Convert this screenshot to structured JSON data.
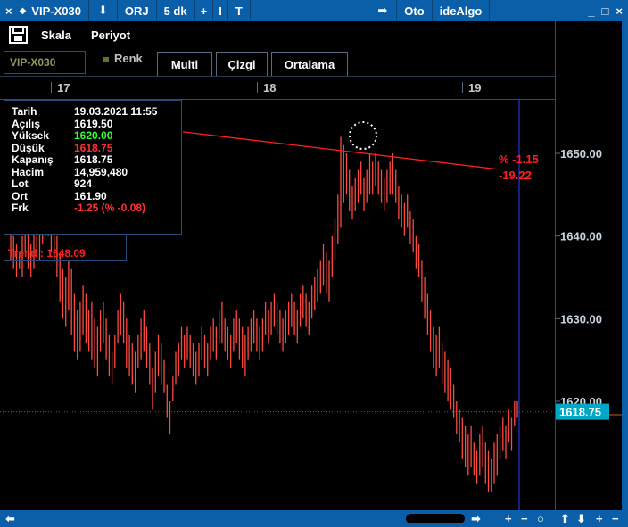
{
  "titlebar": {
    "close": "×",
    "back": "◆",
    "symbol": "VIP-X030",
    "download": "⬇",
    "orj": "ORJ",
    "period": "5 dk",
    "plus": "+",
    "bar": "I",
    "text_tool": "T",
    "arrow": "➡",
    "oto": "Oto",
    "idealgo": "ideAlgo",
    "minimize": "_",
    "maximize": "□",
    "close_win": "×"
  },
  "menu": {
    "scale": "Skala",
    "period": "Periyot"
  },
  "tabs": {
    "symbol_box": "VIP-X030",
    "renk": "Renk",
    "multi": "Multi",
    "cizgi": "Çizgi",
    "ortalama": "Ortalama"
  },
  "time_axis": [
    "17",
    "18",
    "19"
  ],
  "info": {
    "rows": [
      {
        "label": "Tarih",
        "value": "19.03.2021 11:55"
      },
      {
        "label": "Açılış",
        "value": "1619.50"
      },
      {
        "label": "Yüksek",
        "value": "1620.00"
      },
      {
        "label": "Düşük",
        "value": "1618.75"
      },
      {
        "label": "Kapanış",
        "value": "1618.75"
      },
      {
        "label": "Hacim",
        "value": "14,959,480"
      },
      {
        "label": "Lot",
        "value": "924"
      },
      {
        "label": "Ort",
        "value": "161.90"
      },
      {
        "label": "Frk",
        "value": "-1.25 (% -0.08)"
      }
    ],
    "trend": "Trend : 1648.09"
  },
  "trendline_label": {
    "pct": "% -1.15",
    "diff": "-19.22"
  },
  "price_axis": [
    "1650.00",
    "1640.00",
    "1630.00",
    "1620.00"
  ],
  "last_price": "1618.75",
  "colors": {
    "bar": "#ff4a40",
    "trend": "#ff2020",
    "cursor": "#2a40ff",
    "up_text": "#30ff30",
    "down_text": "#ff3030",
    "last_price_bg": "#00a8c8",
    "titlebar": "#0a5fa8"
  },
  "bottombar": {
    "left_arrow": "⬅",
    "right_arrow": "➡",
    "plus": "+",
    "minus": "−",
    "circle": "○",
    "up": "⬆",
    "down": "⬇",
    "plus2": "+",
    "minus2": "−"
  },
  "chart_data": {
    "type": "bar",
    "title": "",
    "xlabel": "",
    "ylabel": "",
    "ylim": [
      1608,
      1662
    ],
    "x_ticks": [
      "17",
      "18",
      "19"
    ],
    "y_ticks": [
      1620,
      1630,
      1640,
      1650
    ],
    "last_value": 1618.75,
    "trendline": [
      1652.6,
      1648.1
    ],
    "points": [
      [
        1641,
        1637
      ],
      [
        1640,
        1636
      ],
      [
        1639,
        1635
      ],
      [
        1638,
        1636
      ],
      [
        1640,
        1635
      ],
      [
        1642,
        1638
      ],
      [
        1641,
        1636
      ],
      [
        1639,
        1635
      ],
      [
        1642,
        1636
      ],
      [
        1643,
        1638
      ],
      [
        1641,
        1637
      ],
      [
        1644,
        1639
      ],
      [
        1646,
        1640
      ],
      [
        1645,
        1640
      ],
      [
        1644,
        1638
      ],
      [
        1643,
        1637
      ],
      [
        1640,
        1635
      ],
      [
        1638,
        1632
      ],
      [
        1636,
        1630
      ],
      [
        1635,
        1629
      ],
      [
        1637,
        1631
      ],
      [
        1636,
        1628
      ],
      [
        1633,
        1626
      ],
      [
        1631,
        1625
      ],
      [
        1632,
        1626
      ],
      [
        1634,
        1628
      ],
      [
        1633,
        1627
      ],
      [
        1631,
        1626
      ],
      [
        1632,
        1625
      ],
      [
        1630,
        1624
      ],
      [
        1629,
        1623
      ],
      [
        1631,
        1626
      ],
      [
        1632,
        1627
      ],
      [
        1630,
        1625
      ],
      [
        1628,
        1623
      ],
      [
        1626,
        1622
      ],
      [
        1628,
        1624
      ],
      [
        1631,
        1627
      ],
      [
        1633,
        1628
      ],
      [
        1632,
        1627
      ],
      [
        1630,
        1624
      ],
      [
        1628,
        1623
      ],
      [
        1627,
        1622
      ],
      [
        1626,
        1621
      ],
      [
        1628,
        1624
      ],
      [
        1630,
        1625
      ],
      [
        1631,
        1626
      ],
      [
        1629,
        1624
      ],
      [
        1627,
        1622
      ],
      [
        1624,
        1619
      ],
      [
        1626,
        1621
      ],
      [
        1628,
        1623
      ],
      [
        1627,
        1622
      ],
      [
        1625,
        1621
      ],
      [
        1622,
        1618
      ],
      [
        1620,
        1616
      ],
      [
        1623,
        1620
      ],
      [
        1626,
        1622
      ],
      [
        1627,
        1623
      ],
      [
        1629,
        1625
      ],
      [
        1628,
        1624
      ],
      [
        1629,
        1625
      ],
      [
        1628,
        1624
      ],
      [
        1627,
        1623
      ],
      [
        1626,
        1622
      ],
      [
        1627,
        1623
      ],
      [
        1629,
        1625
      ],
      [
        1628,
        1624
      ],
      [
        1627,
        1623
      ],
      [
        1629,
        1625
      ],
      [
        1630,
        1626
      ],
      [
        1629,
        1625
      ],
      [
        1631,
        1627
      ],
      [
        1632,
        1627
      ],
      [
        1630,
        1626
      ],
      [
        1629,
        1625
      ],
      [
        1628,
        1624
      ],
      [
        1630,
        1626
      ],
      [
        1631,
        1627
      ],
      [
        1630,
        1625
      ],
      [
        1629,
        1624
      ],
      [
        1628,
        1623
      ],
      [
        1629,
        1625
      ],
      [
        1630,
        1626
      ],
      [
        1631,
        1627
      ],
      [
        1630,
        1626
      ],
      [
        1629,
        1625
      ],
      [
        1630,
        1626
      ],
      [
        1632,
        1628
      ],
      [
        1631,
        1627
      ],
      [
        1632,
        1628
      ],
      [
        1633,
        1629
      ],
      [
        1632,
        1628
      ],
      [
        1631,
        1627
      ],
      [
        1630,
        1626
      ],
      [
        1631,
        1627
      ],
      [
        1632,
        1628
      ],
      [
        1633,
        1629
      ],
      [
        1632,
        1628
      ],
      [
        1631,
        1627
      ],
      [
        1633,
        1629
      ],
      [
        1634,
        1630
      ],
      [
        1633,
        1629
      ],
      [
        1632,
        1628
      ],
      [
        1634,
        1630
      ],
      [
        1635,
        1631
      ],
      [
        1636,
        1632
      ],
      [
        1637,
        1633
      ],
      [
        1639,
        1634
      ],
      [
        1638,
        1633
      ],
      [
        1637,
        1632
      ],
      [
        1640,
        1635
      ],
      [
        1642,
        1637
      ],
      [
        1645,
        1639
      ],
      [
        1652,
        1641
      ],
      [
        1651,
        1644
      ],
      [
        1650,
        1645
      ],
      [
        1648,
        1643
      ],
      [
        1646,
        1642
      ],
      [
        1647,
        1643
      ],
      [
        1648,
        1644
      ],
      [
        1649,
        1645
      ],
      [
        1647,
        1643
      ],
      [
        1648,
        1644
      ],
      [
        1650,
        1645
      ],
      [
        1649,
        1645
      ],
      [
        1650,
        1646
      ],
      [
        1649,
        1645
      ],
      [
        1648,
        1644
      ],
      [
        1647,
        1643
      ],
      [
        1648,
        1644
      ],
      [
        1649,
        1645
      ],
      [
        1650,
        1645
      ],
      [
        1648,
        1644
      ],
      [
        1646,
        1642
      ],
      [
        1645,
        1641
      ],
      [
        1644,
        1640
      ],
      [
        1645,
        1641
      ],
      [
        1643,
        1639
      ],
      [
        1642,
        1638
      ],
      [
        1640,
        1636
      ],
      [
        1639,
        1635
      ],
      [
        1637,
        1632
      ],
      [
        1635,
        1630
      ],
      [
        1633,
        1628
      ],
      [
        1631,
        1626
      ],
      [
        1629,
        1624
      ],
      [
        1628,
        1623
      ],
      [
        1629,
        1624
      ],
      [
        1627,
        1622
      ],
      [
        1626,
        1621
      ],
      [
        1625,
        1620
      ],
      [
        1624,
        1619
      ],
      [
        1622,
        1618
      ],
      [
        1620,
        1616
      ],
      [
        1619,
        1615
      ],
      [
        1618,
        1613
      ],
      [
        1617,
        1612
      ],
      [
        1616,
        1611
      ],
      [
        1617,
        1612
      ],
      [
        1615,
        1611
      ],
      [
        1614,
        1610
      ],
      [
        1616,
        1611
      ],
      [
        1617,
        1612
      ],
      [
        1615,
        1610
      ],
      [
        1614,
        1609
      ],
      [
        1613,
        1609
      ],
      [
        1615,
        1610
      ],
      [
        1616,
        1611
      ],
      [
        1617,
        1613
      ],
      [
        1618,
        1614
      ],
      [
        1617,
        1613
      ],
      [
        1619,
        1615
      ],
      [
        1618,
        1614
      ],
      [
        1620,
        1617
      ],
      [
        1620,
        1618
      ]
    ]
  }
}
